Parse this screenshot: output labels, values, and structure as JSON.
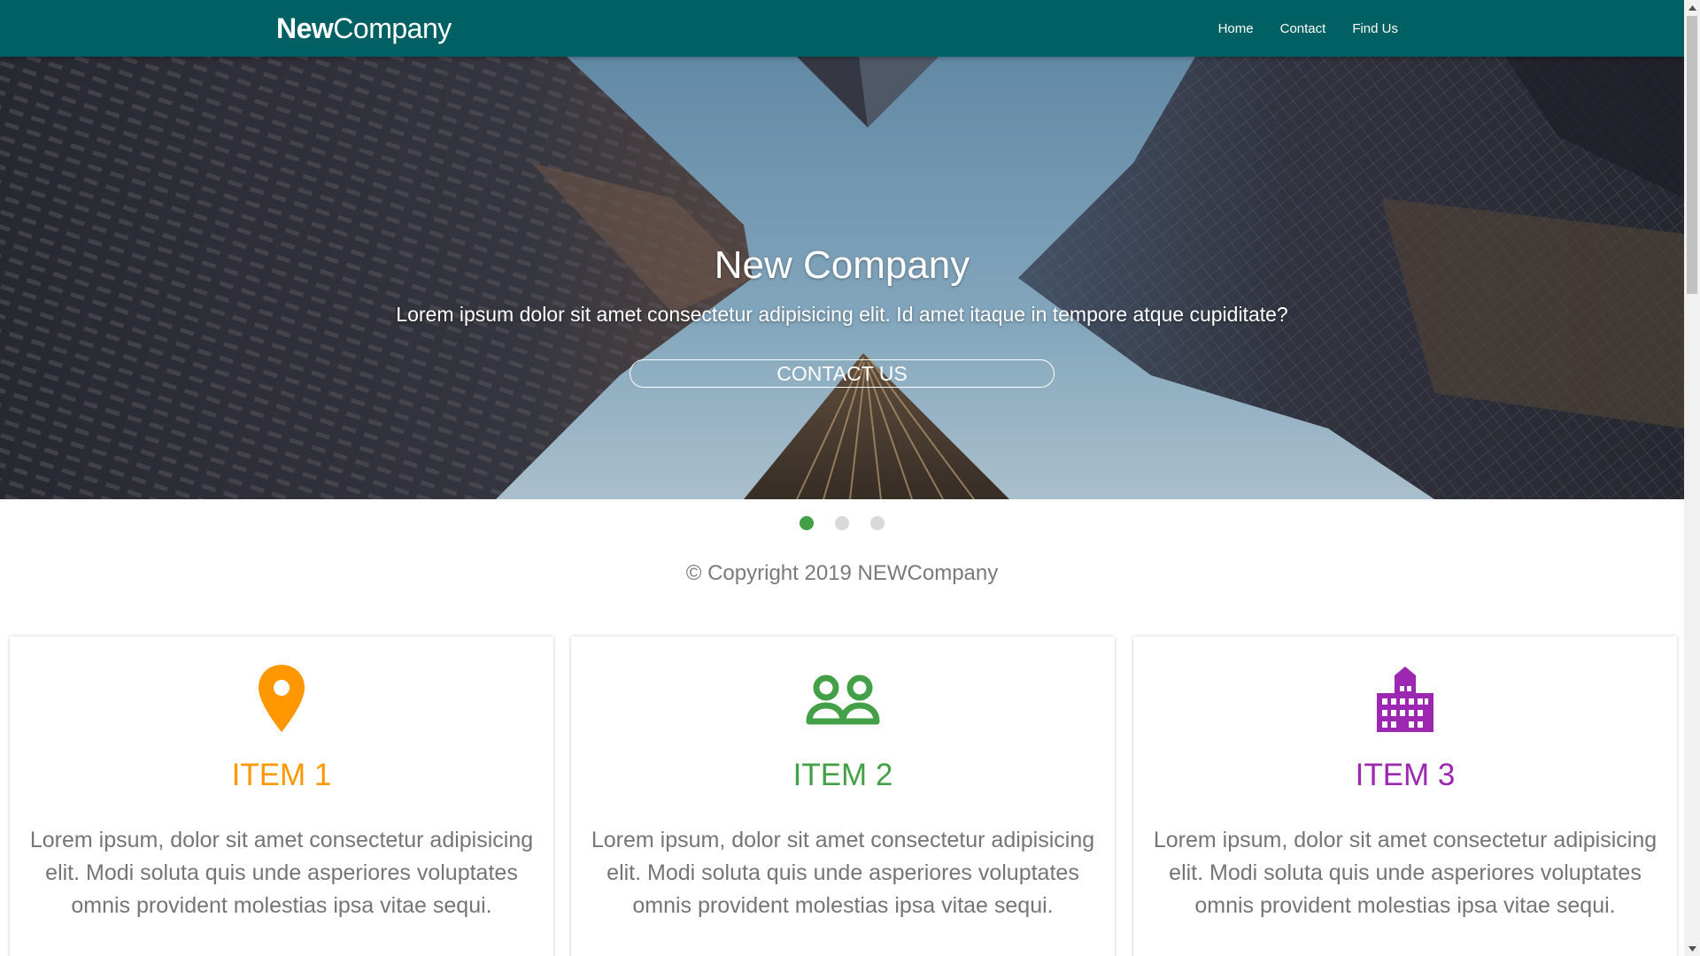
{
  "navbar": {
    "brand_bold": "New",
    "brand_light": "Company",
    "links": [
      "Home",
      "Contact",
      "Find Us"
    ],
    "background": "#006064"
  },
  "hero": {
    "title": "New Company",
    "subtitle": "Lorem ipsum dolor sit amet consectetur adipisicing elit. Id amet itaque in tempore atque cupiditate?",
    "button_label": "CONTACT US"
  },
  "carousel": {
    "slide_count": 3,
    "active_index": 0,
    "active_color": "#43a047",
    "inactive_color": "#d9d9d9"
  },
  "footer": {
    "copyright": "© Copyright 2019 NEWCompany"
  },
  "cards": [
    {
      "icon": "map-marker-icon",
      "title": "ITEM 1",
      "color": "#ff9800",
      "text": "Lorem ipsum, dolor sit amet consectetur adipisicing elit. Modi soluta quis unde asperiores voluptates omnis provident molestias ipsa vitae sequi."
    },
    {
      "icon": "people-icon",
      "title": "ITEM 2",
      "color": "#43a047",
      "text": "Lorem ipsum, dolor sit amet consectetur adipisicing elit. Modi soluta quis unde asperiores voluptates omnis provident molestias ipsa vitae sequi."
    },
    {
      "icon": "building-icon",
      "title": "ITEM 3",
      "color": "#9c27b0",
      "text": "Lorem ipsum, dolor sit amet consectetur adipisicing elit. Modi soluta quis unde asperiores voluptates omnis provident molestias ipsa vitae sequi."
    }
  ]
}
